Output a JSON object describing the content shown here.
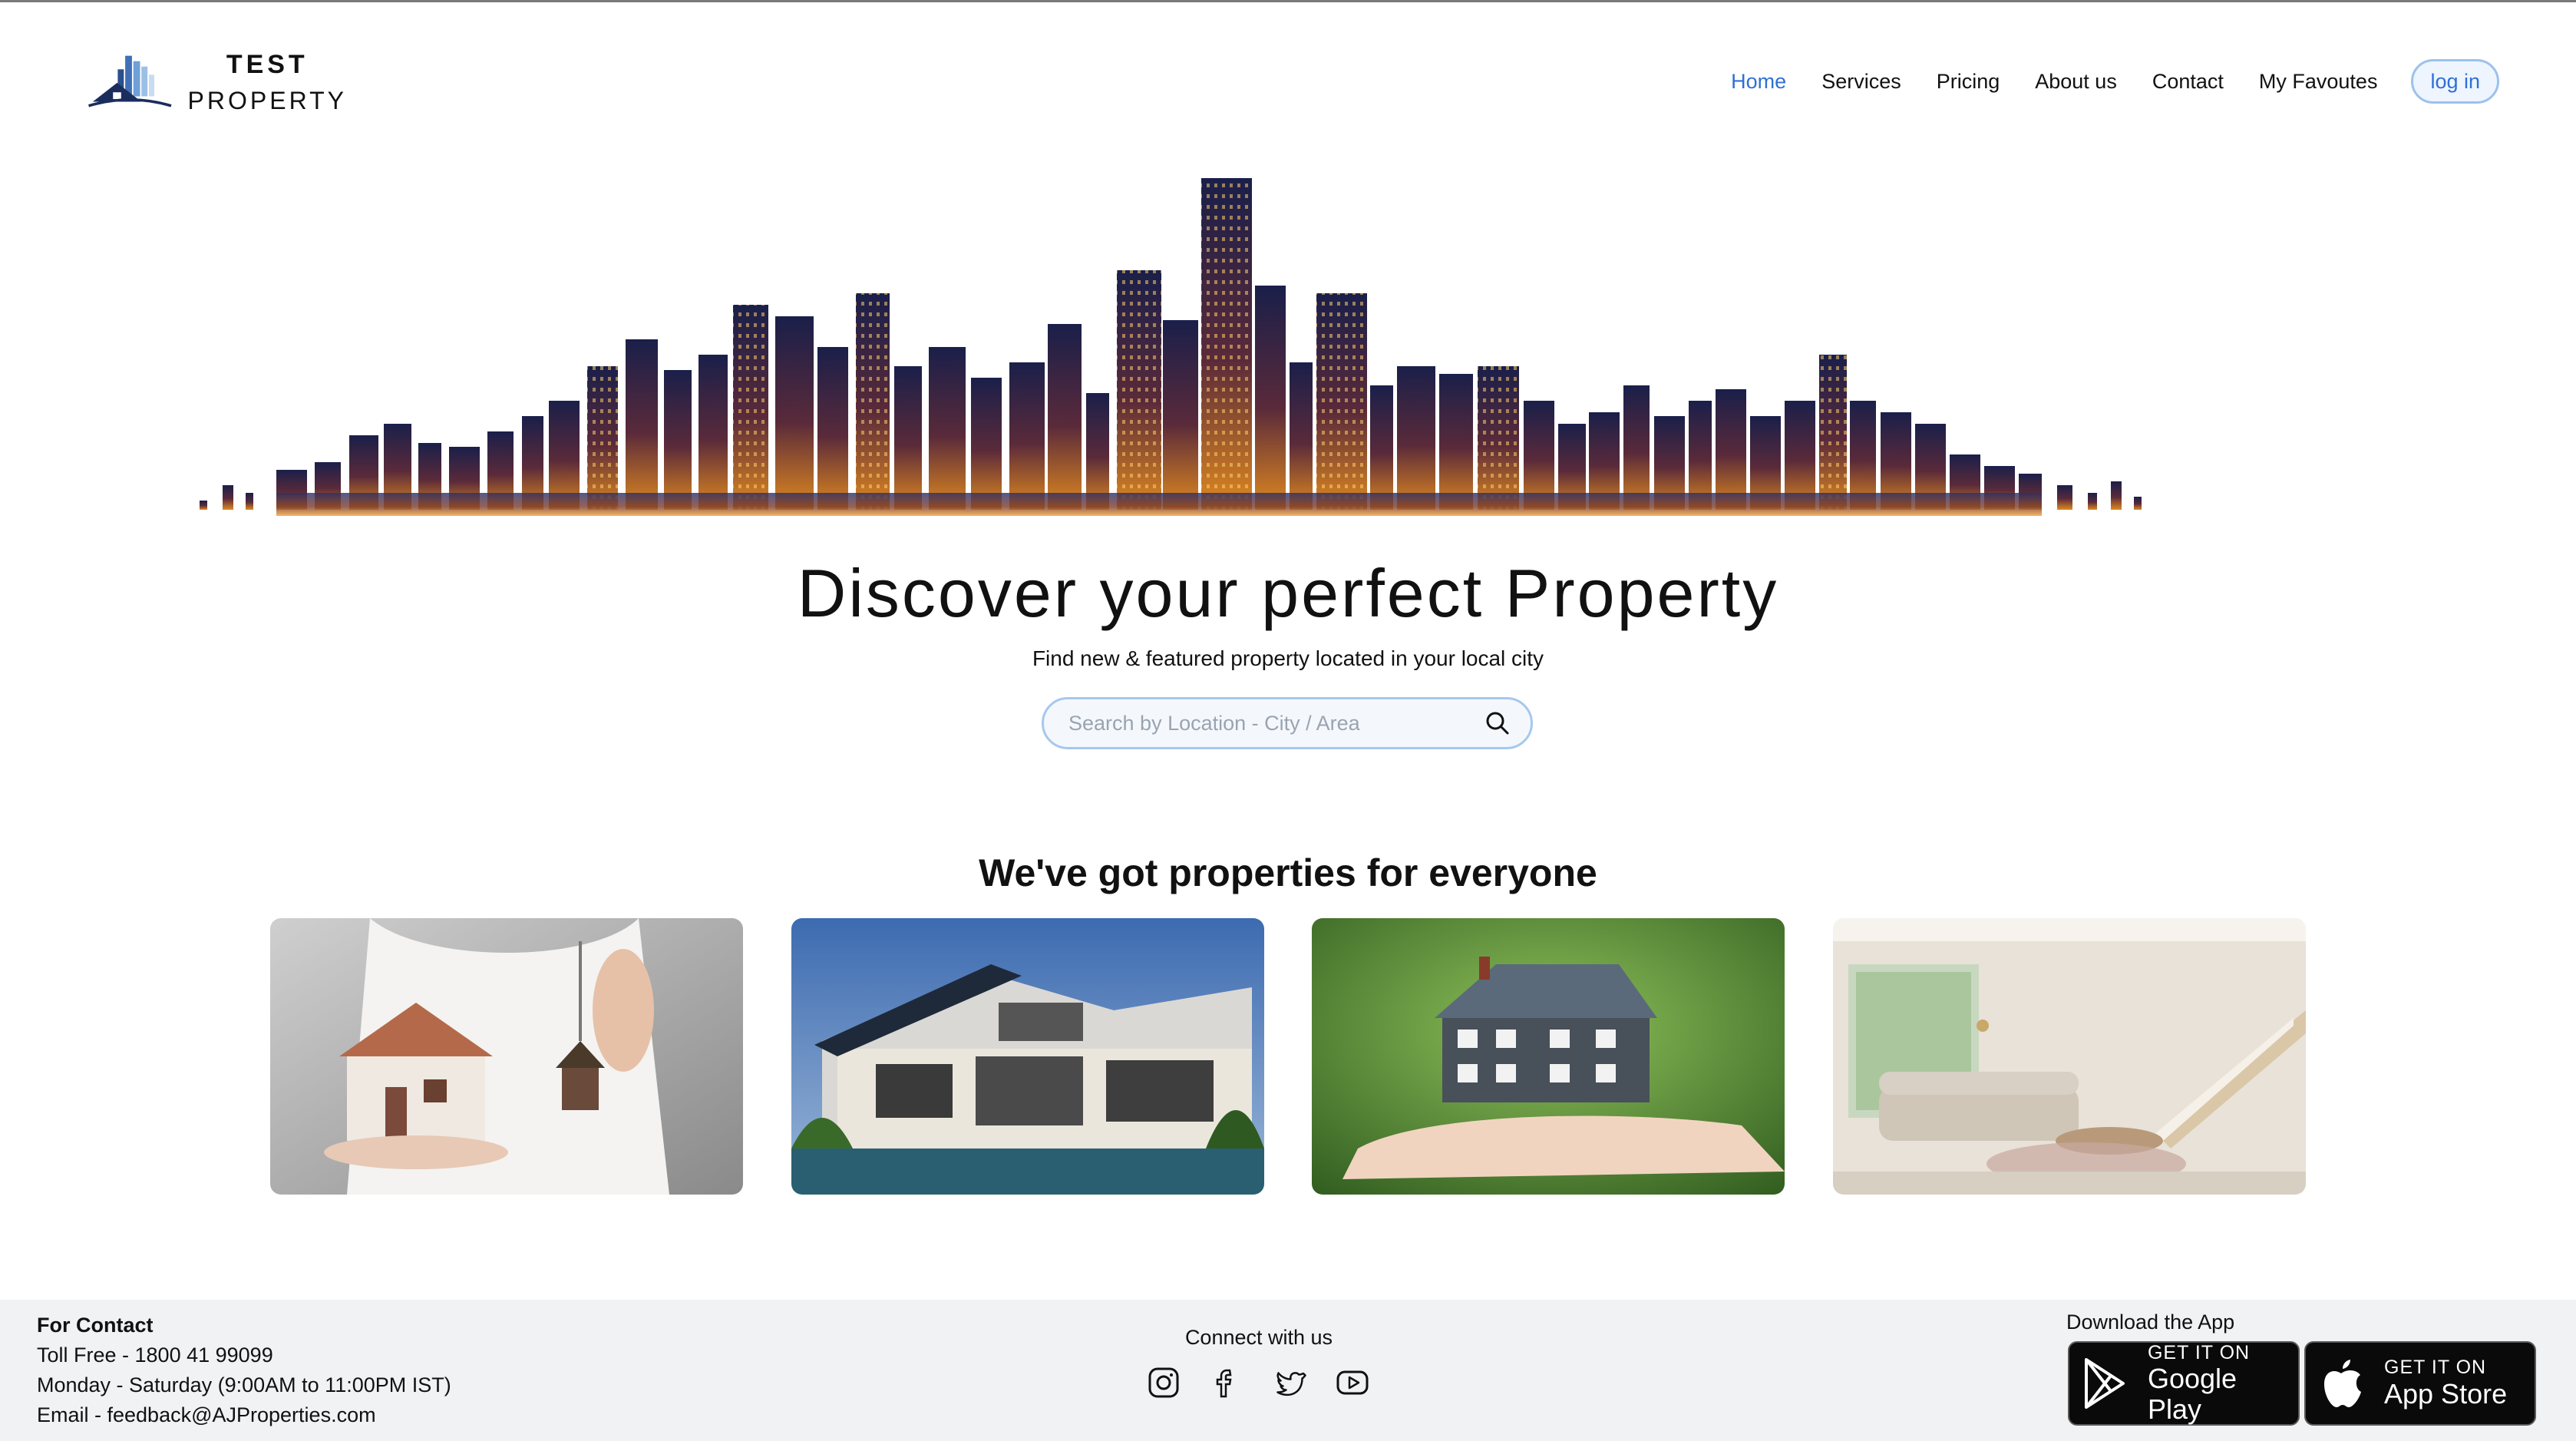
{
  "header": {
    "logo": {
      "line1": "TEST",
      "line2": "PROPERTY"
    },
    "nav": [
      {
        "label": "Home",
        "active": true
      },
      {
        "label": "Services"
      },
      {
        "label": "Pricing"
      },
      {
        "label": "About us"
      },
      {
        "label": "Contact"
      },
      {
        "label": "My Favoutes"
      }
    ],
    "login_label": "log in"
  },
  "hero": {
    "title": "Discover your perfect Property",
    "subtitle": "Find new & featured property located in your local city",
    "search_placeholder": "Search by Location - City / Area"
  },
  "section": {
    "title": "We've got properties for everyone",
    "cards": [
      {
        "icon": "hand-holding-house-and-keys-image"
      },
      {
        "icon": "modern-villa-image"
      },
      {
        "icon": "house-model-in-palm-image"
      },
      {
        "icon": "living-room-interior-image"
      }
    ]
  },
  "footer": {
    "contact": {
      "heading": "For Contact",
      "toll_free": "Toll Free - 1800 41 99099",
      "hours": "Monday - Saturday (9:00AM to 11:00PM IST)",
      "email": "Email - feedback@AJProperties.com"
    },
    "connect_label": "Connect with us",
    "socials": [
      "instagram-icon",
      "facebook-icon",
      "twitter-icon",
      "youtube-icon"
    ],
    "download_label": "Download the App",
    "google_play": {
      "small": "GET IT ON",
      "big": "Google Play"
    },
    "app_store": {
      "small": "GET IT ON",
      "big": "App Store"
    }
  },
  "colors": {
    "accent": "#2f6fd6",
    "footer_bg": "#f1f2f4",
    "search_border": "#a7c8ee"
  }
}
